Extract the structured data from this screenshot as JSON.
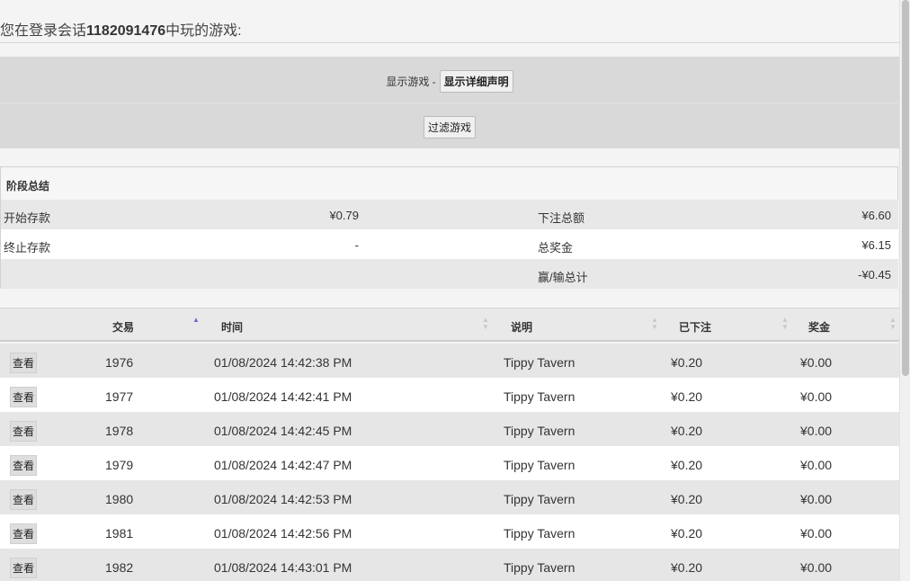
{
  "heading": {
    "prefix": "您在登录会话",
    "session_id": "1182091476",
    "suffix": "中玩的游戏:"
  },
  "filter": {
    "show_games_label": "显示游戏 -",
    "show_details_button": "显示详细声明",
    "filter_button": "过滤游戏"
  },
  "summary": {
    "title": "阶段总结",
    "start_balance_label": "开始存款",
    "start_balance_value": "¥0.79",
    "end_balance_label": "终止存款",
    "end_balance_value": "-",
    "total_bet_label": "下注总额",
    "total_bet_value": "¥6.60",
    "total_prize_label": "总奖金",
    "total_prize_value": "¥6.15",
    "win_loss_label": "赢/输总计",
    "win_loss_value": "-¥0.45"
  },
  "table": {
    "columns": {
      "transaction": "交易",
      "time": "时间",
      "description": "说明",
      "bet": "已下注",
      "prize": "奖金"
    },
    "view_label": "查看",
    "rows": [
      {
        "id": "1976",
        "time": "01/08/2024 14:42:38 PM",
        "desc": "Tippy Tavern",
        "bet": "¥0.20",
        "prize": "¥0.00"
      },
      {
        "id": "1977",
        "time": "01/08/2024 14:42:41 PM",
        "desc": "Tippy Tavern",
        "bet": "¥0.20",
        "prize": "¥0.00"
      },
      {
        "id": "1978",
        "time": "01/08/2024 14:42:45 PM",
        "desc": "Tippy Tavern",
        "bet": "¥0.20",
        "prize": "¥0.00"
      },
      {
        "id": "1979",
        "time": "01/08/2024 14:42:47 PM",
        "desc": "Tippy Tavern",
        "bet": "¥0.20",
        "prize": "¥0.00"
      },
      {
        "id": "1980",
        "time": "01/08/2024 14:42:53 PM",
        "desc": "Tippy Tavern",
        "bet": "¥0.20",
        "prize": "¥0.00"
      },
      {
        "id": "1981",
        "time": "01/08/2024 14:42:56 PM",
        "desc": "Tippy Tavern",
        "bet": "¥0.20",
        "prize": "¥0.00"
      },
      {
        "id": "1982",
        "time": "01/08/2024 14:43:01 PM",
        "desc": "Tippy Tavern",
        "bet": "¥0.20",
        "prize": "¥0.00"
      }
    ]
  },
  "icons": {
    "sort_asc": "sort-ascending-icon",
    "sort_both": "sort-both-icon"
  },
  "colors": {
    "active_sort": "#6c6ccf"
  }
}
